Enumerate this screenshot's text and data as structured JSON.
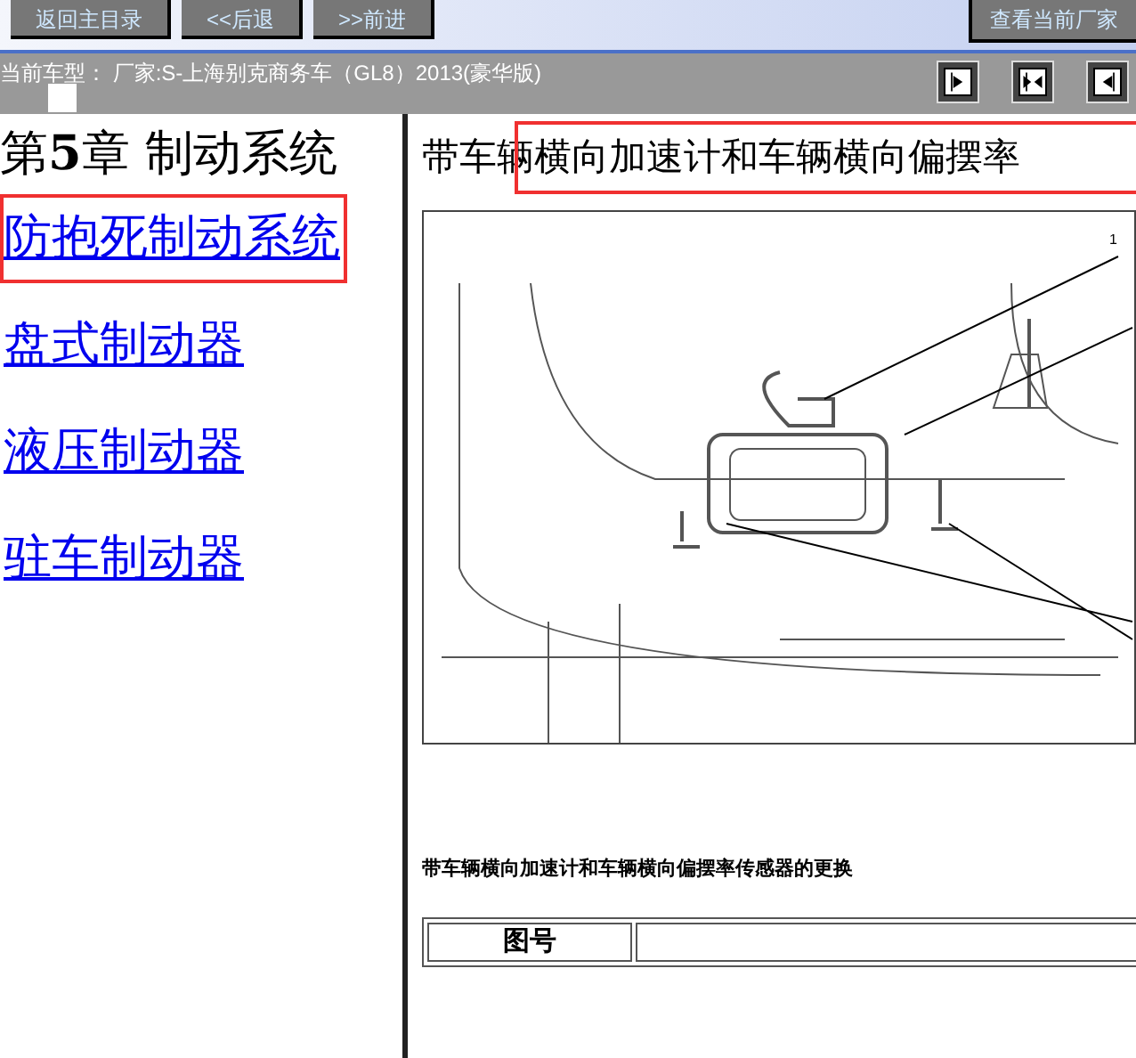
{
  "toolbar": {
    "buttons": [
      {
        "label": "返回主目录"
      },
      {
        "label": "<<后退"
      },
      {
        "label": ">>前进"
      }
    ],
    "right_button": {
      "label": "查看当前厂家"
    }
  },
  "model_bar": {
    "text": "当前车型：  厂家:S-上海别克商务车（GL8）2013(豪华版)"
  },
  "sidebar": {
    "chapter": {
      "prefix": "第",
      "number": "5",
      "suffix": "章 制动系统"
    },
    "items": [
      {
        "label": "防抱死制动系统",
        "selected": true
      },
      {
        "label": "盘式制动器",
        "selected": false
      },
      {
        "label": "液压制动器",
        "selected": false
      },
      {
        "label": "驻车制动器",
        "selected": false
      }
    ]
  },
  "content": {
    "title": "带车辆横向加速计和车辆横向偏摆率",
    "title_highlighted": true,
    "figure": {
      "callout": "1"
    },
    "caption": "带车辆横向加速计和车辆横向偏摆率传感器的更换",
    "table": {
      "column_1": "图号"
    }
  }
}
